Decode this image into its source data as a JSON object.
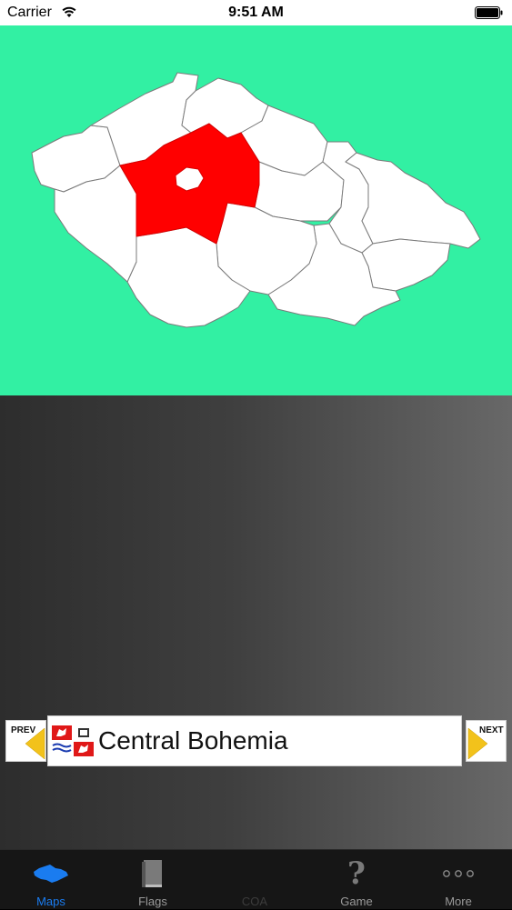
{
  "status_bar": {
    "carrier": "Carrier",
    "time": "9:51 AM"
  },
  "map": {
    "background_color": "#32f0a3",
    "selected_region_color": "#ff0000",
    "region_fill": "#ffffff"
  },
  "selector": {
    "prev_label": "PREV",
    "next_label": "NEXT",
    "region_name": "Central Bohemia"
  },
  "tab_bar": {
    "tabs": [
      {
        "label": "Maps",
        "icon": "map-icon",
        "active": true
      },
      {
        "label": "Flags",
        "icon": "book-icon",
        "active": false
      },
      {
        "label": "COA",
        "icon": "coa-icon",
        "active": false
      },
      {
        "label": "Game",
        "icon": "question-icon",
        "active": false
      },
      {
        "label": "More",
        "icon": "more-icon",
        "active": false
      }
    ],
    "active_color": "#1a7cf0"
  }
}
